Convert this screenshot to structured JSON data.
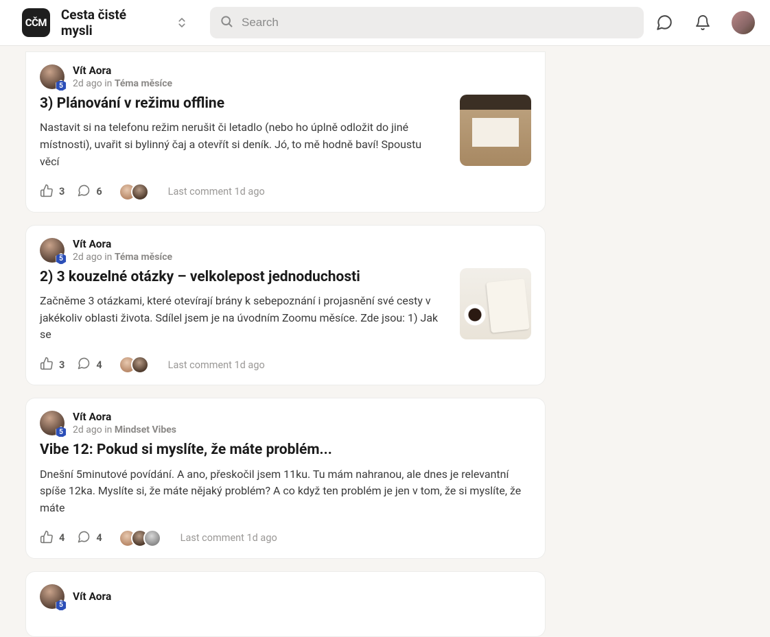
{
  "header": {
    "badge_text": "CČM",
    "app_title": "Cesta čisté mysli",
    "search_placeholder": "Search"
  },
  "author_badge_level": "5",
  "posts": [
    {
      "author": "Vít Aora",
      "time": "2d ago",
      "in_word": "in",
      "category": "Téma měsíce",
      "title": "3) Plánování v režimu offline",
      "excerpt": "Nastavit si na telefonu režim nerušit či letadlo (nebo ho úplně odložit do jiné místnosti), uvařit si bylinný čaj a otevřít si deník. Jó, to mě hodně baví! Spoustu věcí",
      "likes": "3",
      "comments": "6",
      "last_comment": "Last comment 1d ago",
      "thumb": "journal",
      "commenter_count": 2
    },
    {
      "author": "Vít Aora",
      "time": "2d ago",
      "in_word": "in",
      "category": "Téma měsíce",
      "title": "2) 3 kouzelné otázky – velkolepost jednoduchosti",
      "excerpt": "Začněme 3 otázkami, které otevírají brány k sebepoznání i projasnění své cesty v jakékoliv oblasti života. Sdílel jsem je na úvodním Zoomu měsíce. Zde jsou: 1) Jak se",
      "likes": "3",
      "comments": "4",
      "last_comment": "Last comment 1d ago",
      "thumb": "coffee",
      "commenter_count": 2
    },
    {
      "author": "Vít Aora",
      "time": "2d ago",
      "in_word": "in",
      "category": "Mindset Vibes",
      "title": "Vibe 12: Pokud si myslíte, že máte problém...",
      "excerpt": "Dnešní 5minutové povídání. A ano, přeskočil jsem 11ku. Tu mám nahranou, ale dnes je relevantní spíše 12ka. Myslíte si, že máte nějaký problém? A co když ten problém je jen v tom, že si myslíte, že máte",
      "likes": "4",
      "comments": "4",
      "last_comment": "Last comment 1d ago",
      "thumb": "",
      "commenter_count": 3
    },
    {
      "author": "Vít Aora",
      "time": "",
      "in_word": "",
      "category": "",
      "title": "",
      "excerpt": "",
      "likes": "",
      "comments": "",
      "last_comment": "",
      "thumb": "",
      "commenter_count": 0
    }
  ]
}
